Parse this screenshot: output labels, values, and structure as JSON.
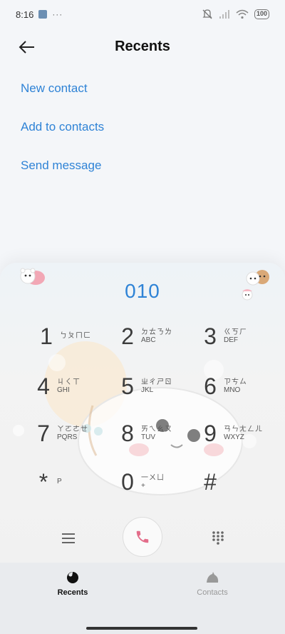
{
  "status_bar": {
    "time": "8:16",
    "battery": "100"
  },
  "header": {
    "title": "Recents",
    "back_icon": "back-arrow-icon"
  },
  "actions": {
    "new_contact": "New contact",
    "add_to_contacts": "Add to contacts",
    "send_message": "Send message"
  },
  "dialpad": {
    "entered_number": "010",
    "keys": [
      {
        "digit": "1",
        "bpmf": "ㄅㄆㄇㄈ",
        "letters": ""
      },
      {
        "digit": "2",
        "bpmf": "ㄉㄊㄋㄌ",
        "letters": "ABC"
      },
      {
        "digit": "3",
        "bpmf": "ㄍㄎㄏ",
        "letters": "DEF"
      },
      {
        "digit": "4",
        "bpmf": "ㄐㄑㄒ",
        "letters": "GHI"
      },
      {
        "digit": "5",
        "bpmf": "ㄓㄔㄕㄖ",
        "letters": "JKL"
      },
      {
        "digit": "6",
        "bpmf": "ㄗㄘㄙ",
        "letters": "MNO"
      },
      {
        "digit": "7",
        "bpmf": "ㄚㄛㄜㄝ",
        "letters": "PQRS"
      },
      {
        "digit": "8",
        "bpmf": "ㄞㄟㄠㄡ",
        "letters": "TUV"
      },
      {
        "digit": "9",
        "bpmf": "ㄢㄣㄤㄥㄦ",
        "letters": "WXYZ"
      },
      {
        "digit": "*",
        "bpmf": "",
        "letters": "P"
      },
      {
        "digit": "0",
        "bpmf": "一ㄨㄩ",
        "letters": "+"
      },
      {
        "digit": "#",
        "bpmf": "",
        "letters": ""
      }
    ]
  },
  "toolbar": {
    "menu_icon": "menu-icon",
    "call_icon": "phone-icon",
    "keypad_icon": "keypad-icon"
  },
  "nav": {
    "recents": "Recents",
    "contacts": "Contacts"
  },
  "colors": {
    "accent": "#2f83d6",
    "call": "#e36d8a"
  }
}
